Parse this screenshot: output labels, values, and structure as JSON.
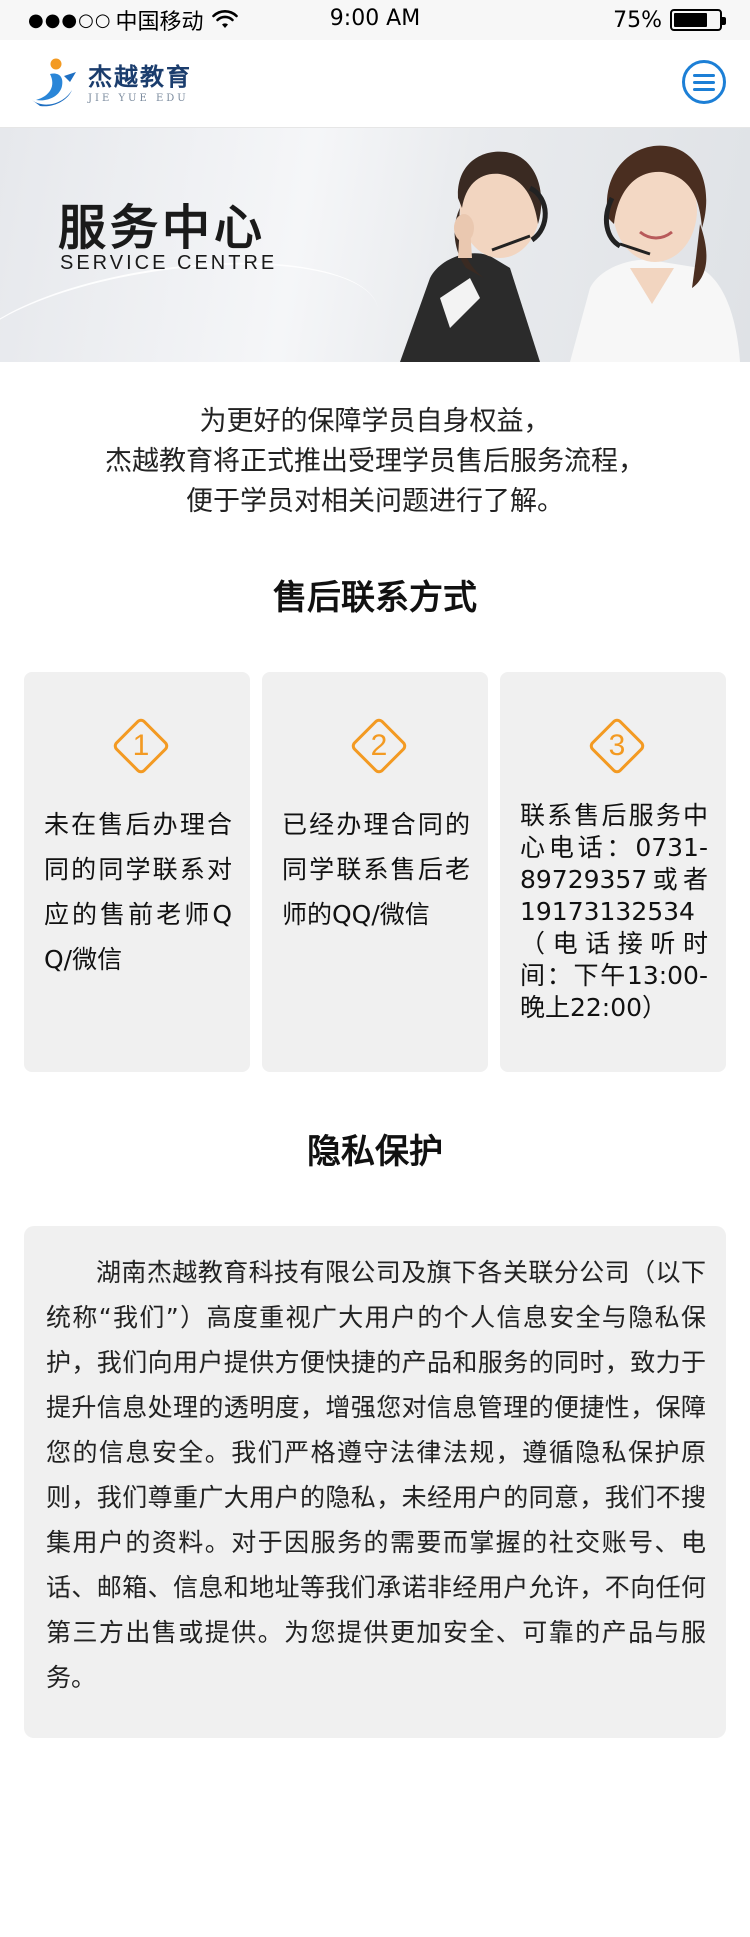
{
  "status_bar": {
    "signal": "●●●○○",
    "carrier": "中国移动",
    "time": "9:00 AM",
    "battery_percent": "75%",
    "battery_level": 0.75
  },
  "header": {
    "logo_cn": "杰越教育",
    "logo_en": "JIE YUE EDU",
    "menu_icon": "hamburger-menu-icon"
  },
  "banner": {
    "title": "服务中心",
    "subtitle": "SERVICE CENTRE"
  },
  "intro": {
    "lines": [
      "为更好的保障学员自身权益，",
      "杰越教育将正式推出受理学员售后服务流程，",
      "便于学员对相关问题进行了解。"
    ]
  },
  "contact": {
    "title": "售后联系方式",
    "cards": [
      {
        "number": "1",
        "text": "未在售后办理合同的同学联系对应的售前老师QQ/微信"
      },
      {
        "number": "2",
        "text": "已经办理合同的同学联系售后老师的QQ/微信"
      },
      {
        "number": "3",
        "text": "联系售后服务中心电话：0731-89729357或者19173132534（电话接听时间：下午13:00-晚上22:00）"
      }
    ]
  },
  "privacy": {
    "title": "隐私保护",
    "text": "湖南杰越教育科技有限公司及旗下各关联分公司（以下统称“我们”）高度重视广大用户的个人信息安全与隐私保护，我们向用户提供方便快捷的产品和服务的同时，致力于提升信息处理的透明度，增强您对信息管理的便捷性，保障您的信息安全。我们严格遵守法律法规，遵循隐私保护原则，我们尊重广大用户的隐私，未经用户的同意，我们不搜集用户的资料。对于因服务的需要而掌握的社交账号、电话、邮箱、信息和地址等我们承诺非经用户允许，不向任何第三方出售或提供。为您提供更加安全、可靠的产品与服务。"
  },
  "colors": {
    "accent_orange": "#f39a22",
    "menu_blue": "#1c7fd6",
    "card_bg": "#f0f0f0"
  }
}
